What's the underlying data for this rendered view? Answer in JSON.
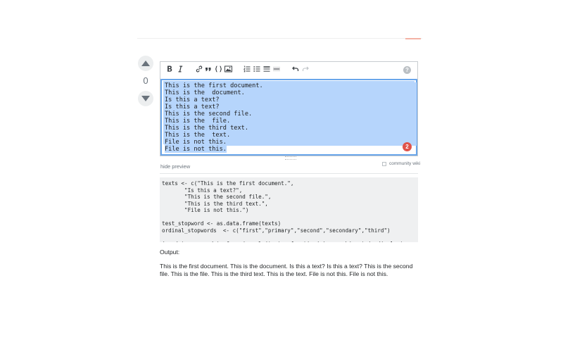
{
  "vote": {
    "count": "0"
  },
  "editor": {
    "help": "?",
    "lines": [
      "This is the first document.",
      "This is the  document.",
      "Is this a text?",
      "Is this a text?",
      "This is the second file.",
      "This is the  file.",
      "This is the third text.",
      "This is the  text.",
      "File is not this.",
      "File is not this."
    ],
    "badge": "2"
  },
  "links": {
    "hide_preview": "hide preview",
    "community_wiki": "community wiki"
  },
  "preview": {
    "code": "texts <- c(\"This is the first document.\",\n       \"Is this a text?\",\n       \"This is the second file.\",\n       \"This is the third text.\",\n       \"File is not this.\")\n\ntest_stopword <- as.data.frame(texts)\nordinal_stopwords  <- c(\"first\",\"primary\",\"second\",\"secondary\",\"third\")\n\n(newdata <- as.data.frame(sapply(texts, function(x)   gsub(paste(ordinal_stopwords,",
    "output_label": "Output:",
    "output_text": "This is the first document. This is the document. Is this a text? Is this a text? This is the second file. This is the file. This is the third text. This is the text. File is not this. File is not this."
  }
}
